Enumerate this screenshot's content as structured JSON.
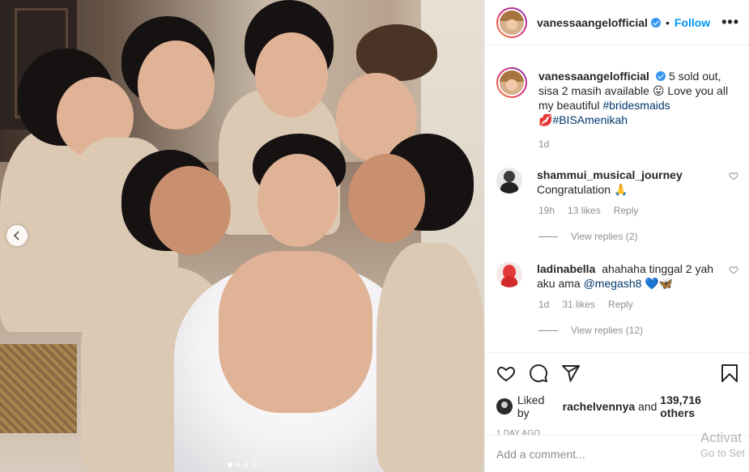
{
  "post": {
    "author": "vanessaangelofficial",
    "follow_label": "Follow",
    "separator": "•",
    "more_label": "•••",
    "caption_part1": "5 sold out, sisa 2 masih available 😛 Love you all my beautiful ",
    "caption_hashtag1": "#bridesmaids",
    "caption_emoji": "💋",
    "caption_hashtag2": "#BISAmenikah",
    "caption_age": "1d"
  },
  "comments": [
    {
      "username": "shammui_musical_journey",
      "text": "Congratulation 🙏",
      "age": "19h",
      "likes": "13 likes",
      "reply_label": "Reply",
      "view_replies": "View replies (2)"
    },
    {
      "username": "ladinabella",
      "text_part1": "ahahaha tinggal 2 yah aku ama ",
      "mention": "@megash8",
      "text_part2": " 💙🦋",
      "age": "1d",
      "likes": "31 likes",
      "reply_label": "Reply",
      "view_replies": "View replies (12)"
    }
  ],
  "likes": {
    "prefix": "Liked by ",
    "user": "rachelvennya",
    "middle": " and ",
    "count": "139,716 others"
  },
  "date": "1 DAY AGO",
  "add_comment": {
    "placeholder": "Add a comment..."
  },
  "overlay": {
    "line1": "Activat",
    "line2": "Go to Set"
  },
  "icons": {
    "like": "heart-icon",
    "comment": "comment-icon",
    "share": "share-icon",
    "save": "bookmark-icon",
    "prev": "chevron-left-icon"
  },
  "carousel": {
    "total_slides": 4,
    "active_slide": 1
  },
  "colors": {
    "link": "#00376b",
    "follow": "#0095f6",
    "muted": "#8e8e8e",
    "text": "#262626"
  }
}
